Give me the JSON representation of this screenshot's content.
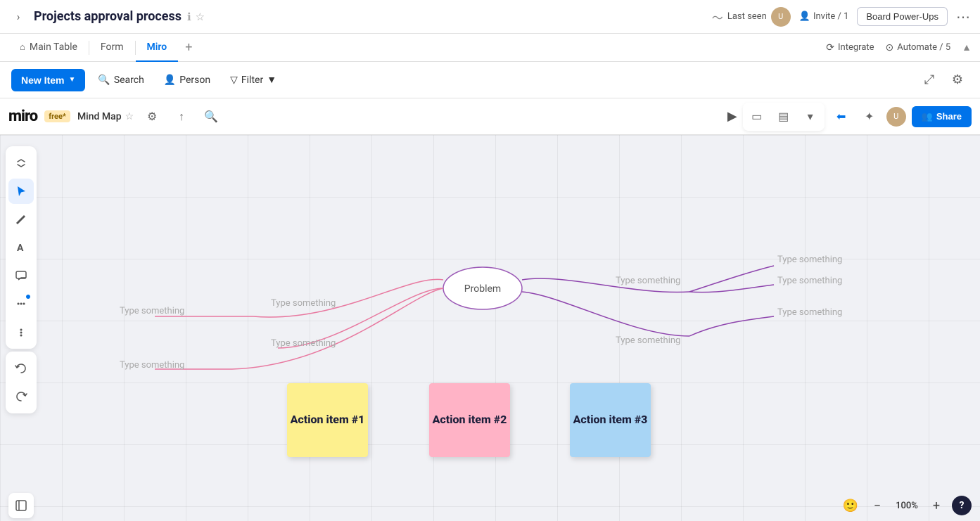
{
  "topbar": {
    "page_title": "Projects approval process",
    "last_seen_label": "Last seen",
    "invite_label": "Invite / 1",
    "board_powerups_label": "Board Power-Ups",
    "more_icon": "⋯"
  },
  "tabs": {
    "items": [
      {
        "label": "Main Table",
        "active": false
      },
      {
        "label": "Form",
        "active": false
      },
      {
        "label": "Miro",
        "active": true
      }
    ],
    "add_label": "+",
    "integrate_label": "Integrate",
    "automate_label": "Automate / 5"
  },
  "toolbar": {
    "new_item_label": "New Item",
    "search_label": "Search",
    "person_label": "Person",
    "filter_label": "Filter"
  },
  "miro": {
    "logo": "miro",
    "free_badge": "free*",
    "mode_label": "Mind Map",
    "share_label": "Share",
    "zoom_level": "100%",
    "problem_node": "Problem",
    "type_something": "Type something",
    "sticky_notes": [
      {
        "label": "Action item #1",
        "color": "#fdf08e"
      },
      {
        "label": "Action item #2",
        "color": "#ffb3c6"
      },
      {
        "label": "Action item #3",
        "color": "#a8d5f5"
      }
    ]
  }
}
